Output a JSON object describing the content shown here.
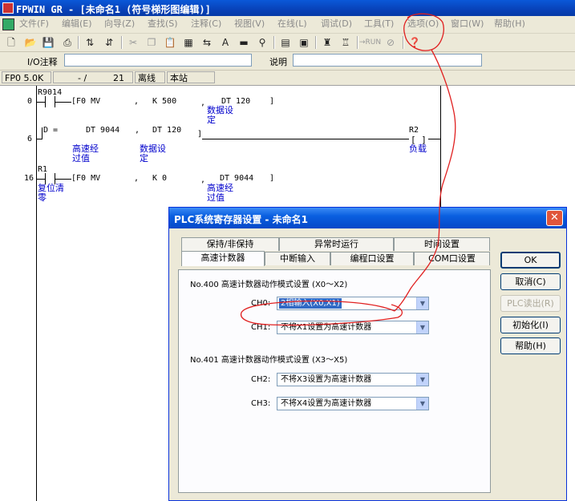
{
  "window": {
    "title": "FPWIN GR - [未命名1 (符号梯形图编辑)]"
  },
  "menu": {
    "items": [
      "文件(F)",
      "编辑(E)",
      "向导(Z)",
      "查找(S)",
      "注释(C)",
      "视图(V)",
      "在线(L)",
      "调试(D)",
      "工具(T)",
      "选项(O)",
      "窗口(W)",
      "帮助(H)"
    ]
  },
  "toolbar": {
    "run_label": "→RUN"
  },
  "io_row": {
    "io_comment_label": "I/O注释",
    "io_comment_value": "",
    "description_label": "说明",
    "description_value": ""
  },
  "status": {
    "plc_model": "FP0 5.0K",
    "position_sep": "- /",
    "position": "21",
    "mode": "离线",
    "station": "本站"
  },
  "ladder": {
    "rungs": [
      {
        "step": "0",
        "contact": "R9014",
        "instr": "[F0 MV",
        "op1_sep": ",",
        "op1": "K 500",
        "op2_sep": ",",
        "op2": "DT 120",
        "close": "]",
        "op2_comment_1": "数据设",
        "op2_comment_2": "定"
      },
      {
        "step": "6",
        "compare": "D =",
        "op1": "DT 9044",
        "op1_sep": ",",
        "op2": "DT 120",
        "close": "]",
        "coil": "R2",
        "coil_comment": "负载",
        "op1_comment_1": "高速经",
        "op1_comment_2": "过值",
        "op2_comment_1": "数据设",
        "op2_comment_2": "定"
      },
      {
        "step": "16",
        "contact": "R1",
        "contact_comment_1": "复位清",
        "contact_comment_2": "零",
        "instr": "[F0 MV",
        "op1_sep": ",",
        "op1": "K 0",
        "op2_sep": ",",
        "op2": "DT 9044",
        "close": "]",
        "op2_comment_1": "高速经",
        "op2_comment_2": "过值"
      }
    ]
  },
  "dialog": {
    "title": "PLC系统寄存器设置 - 未命名1",
    "close_glyph": "✕",
    "tabs_back": [
      "保持/非保持",
      "异常时运行",
      "时间设置"
    ],
    "tabs_front": [
      "高速计数器",
      "中断输入",
      "编程口设置",
      "COM口设置"
    ],
    "active_tab": "高速计数器",
    "group1_title": "No.400  高速计数器动作模式设置 (X0～X2)",
    "group2_title": "No.401  高速计数器动作模式设置 (X3～X5)",
    "fields": [
      {
        "label": "CH0:",
        "value": "2相输入(X0,X1)"
      },
      {
        "label": "CH1:",
        "value": "不将X1设置为高速计数器"
      },
      {
        "label": "CH2:",
        "value": "不将X3设置为高速计数器"
      },
      {
        "label": "CH3:",
        "value": "不将X4设置为高速计数器"
      }
    ],
    "buttons": {
      "ok": "OK",
      "cancel": "取消(C)",
      "plc_read": "PLC读出(R)",
      "init": "初始化(I)",
      "help": "帮助(H)"
    }
  },
  "colors": {
    "titlebar": "#0842b8",
    "dialog_title": "#0a5fe0",
    "comment_text": "#0000cc",
    "annotation": "#e02020",
    "selection": "#316ac5"
  }
}
